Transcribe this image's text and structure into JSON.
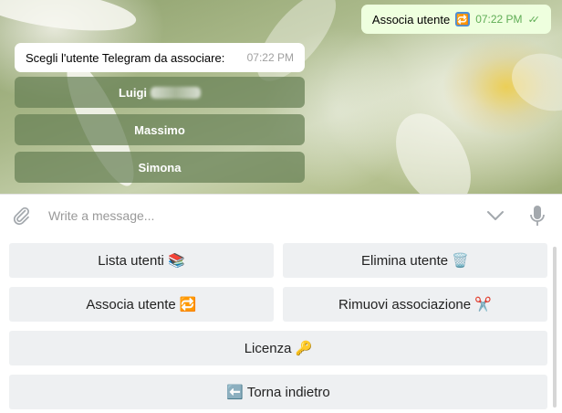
{
  "messages": {
    "outgoing": {
      "text": "Associa utente",
      "emoji": "🔁",
      "time": "07:22 PM",
      "ticks": "✓✓"
    },
    "incoming": {
      "text": "Scegli l'utente Telegram da associare:",
      "time": "07:22 PM"
    },
    "inline_buttons": [
      {
        "label": "Luigi"
      },
      {
        "label": "Massimo"
      },
      {
        "label": "Simona"
      }
    ]
  },
  "composer": {
    "placeholder": "Write a message...",
    "icons": [
      "paperclip-icon",
      "chevron-down-icon",
      "microphone-icon"
    ]
  },
  "keyboard": {
    "lista_utenti": "Lista utenti 📚",
    "elimina_utente": "Elimina utente 🗑️",
    "associa_utente": "Associa utente 🔁",
    "rimuovi_associazione": "Rimuovi associazione ✂️",
    "licenza": "Licenza 🔑",
    "torna_indietro": "⬅️ Torna indietro"
  },
  "colors": {
    "outgoing_bubble": "#eeffde",
    "incoming_bubble": "#ffffff",
    "inline_button": "#668054",
    "keyboard_button": "#eef0f2",
    "tick_green": "#5fad55"
  }
}
